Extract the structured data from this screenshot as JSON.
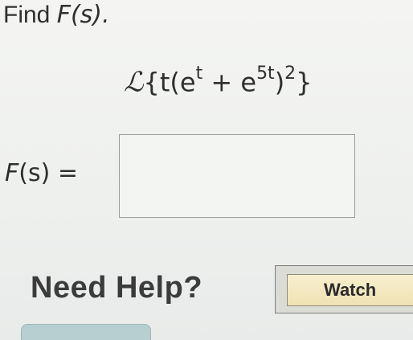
{
  "question": {
    "prompt_word": "Find",
    "prompt_math": "F(s)."
  },
  "expression": {
    "symbol": "ℒ",
    "open_brace": "{",
    "body_start": "t(e",
    "exp1": "t",
    "plus": " + e",
    "exp2": "5t",
    "close_paren": ")",
    "power": "2",
    "close_brace": "}"
  },
  "answer": {
    "label_func": "F",
    "label_rest": "(s) =",
    "value": ""
  },
  "help": {
    "label": "Need Help?",
    "watch_label": "Watch"
  }
}
